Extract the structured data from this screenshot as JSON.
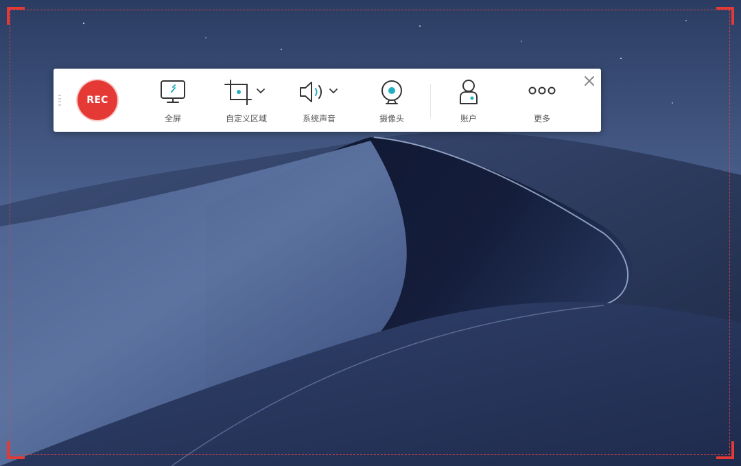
{
  "toolbar": {
    "rec_label": "REC",
    "tools": [
      {
        "id": "fullscreen",
        "label": "全屏",
        "icon": "monitor-icon"
      },
      {
        "id": "custom-area",
        "label": "自定义区域",
        "icon": "crop-icon"
      },
      {
        "id": "system-sound",
        "label": "系统声音",
        "icon": "speaker-icon"
      },
      {
        "id": "camera",
        "label": "摄像头",
        "icon": "webcam-icon"
      },
      {
        "id": "account",
        "label": "账户",
        "icon": "user-icon"
      },
      {
        "id": "more",
        "label": "更多",
        "icon": "more-dots-icon"
      }
    ],
    "close_icon": "close-icon"
  },
  "colors": {
    "accent_red": "#e53935",
    "icon_teal": "#22b0c0",
    "icon_stroke": "#333333",
    "label_gray": "#555555"
  }
}
